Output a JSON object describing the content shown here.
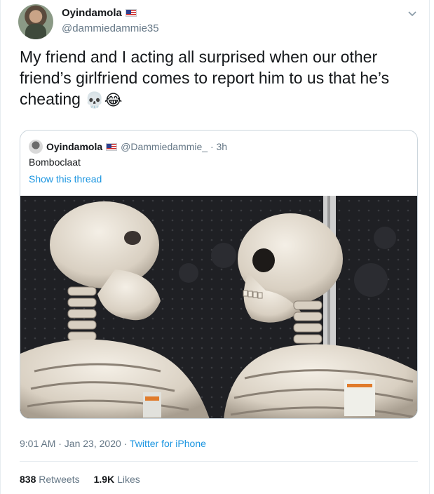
{
  "author": {
    "display_name": "Oyindamola",
    "handle": "@dammiedammie35"
  },
  "tweet": {
    "text": "My friend and I acting all surprised when our other friend’s girlfriend comes to report him to us that he’s cheating",
    "emojis": [
      "💀",
      "😂"
    ],
    "time": "9:01 AM · Jan 23, 2020 · ",
    "source": "Twitter for iPhone",
    "retweets_count": "838",
    "retweets_label": "Retweets",
    "likes_count": "1.9K",
    "likes_label": "Likes"
  },
  "quoted": {
    "display_name": "Oyindamola",
    "handle_time": "@Dammiedammie_ · 3h",
    "text": "Bomboclaat",
    "link": "Show this thread"
  },
  "icons": {
    "caret": "chevron-down-icon",
    "flag": "us-flag-icon"
  }
}
